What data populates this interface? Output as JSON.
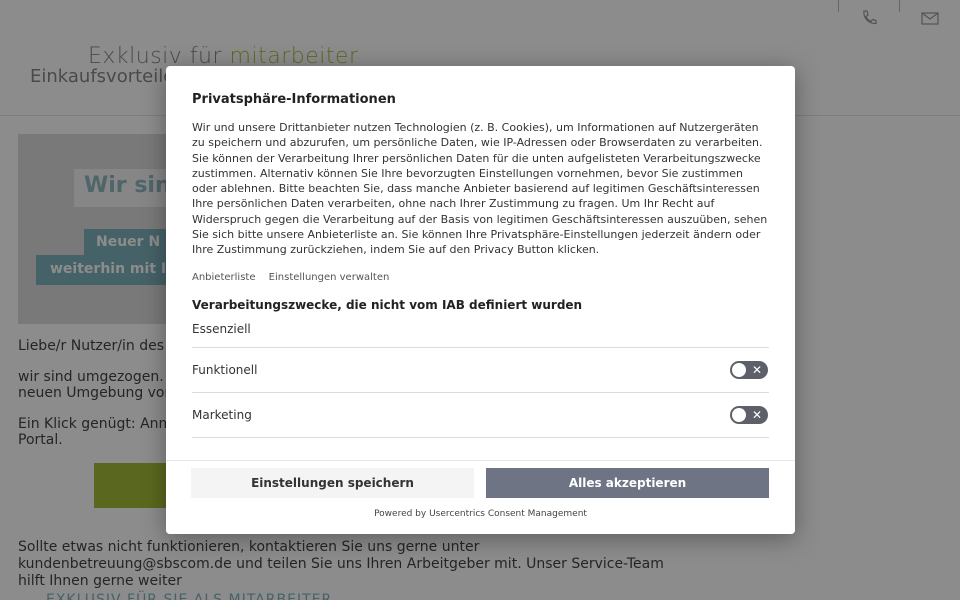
{
  "background": {
    "logo_line1": "Exklusiv für",
    "logo_accent": "mitarbeiter",
    "logo_line2": "Einkaufsvorteile",
    "hero_title": "Wir sind",
    "hero_badge1": "Neuer N",
    "hero_badge2": "weiterhin mit I",
    "greeting": "Liebe/r Nutzer/in des M",
    "para1_line1": "wir sind umgezogen. Ih",
    "para1_line2": "neuen Umgebung von",
    "para2_line1": "Ein Klick genügt: Anme",
    "para2_line2": "Portal.",
    "contact_line1": "Sollte etwas nicht funktionieren, kontaktieren Sie uns gerne unter",
    "contact_email": "kundenbetreuung@sbscom.de",
    "contact_line2_rest": " und teilen Sie uns Ihren Arbeitgeber mit. Unser Service-Team",
    "contact_line3": "hilft Ihnen gerne weiter",
    "footer_link": "EXKLUSIV FÜR SIE ALS MITARBEITER"
  },
  "modal": {
    "title": "Privatsphäre-Informationen",
    "description": "Wir und unsere Drittanbieter nutzen Technologien (z. B. Cookies), um Informationen auf Nutzergeräten zu speichern und abzurufen, um persönliche Daten, wie IP-Adressen oder Browserdaten zu verarbeiten. Sie können der Verarbeitung Ihrer persönlichen Daten für die unten aufgelisteten Verarbeitungszwecke zustimmen. Alternativ können Sie Ihre bevorzugten Einstellungen vornehmen, bevor Sie zustimmen oder ablehnen. Bitte beachten Sie, dass manche Anbieter basierend auf legitimen Geschäftsinteressen Ihre persönlichen Daten verarbeiten, ohne nach Ihrer Zustimmung zu fragen. Um Ihr Recht auf Widerspruch gegen die Verarbeitung auf der Basis von legitimen Geschäftsinteressen auszuüben, sehen Sie sich bitte unsere Anbieterliste an. Sie können Ihre Privatsphäre-Einstellungen jederzeit ändern oder Ihre Zustimmung zurückziehen, indem Sie auf den Privacy Button klicken.",
    "link_vendors": "Anbieterliste",
    "link_settings": "Einstellungen verwalten",
    "section_title": "Verarbeitungszwecke, die nicht vom IAB definiert wurden",
    "categories": [
      {
        "label": "Essenziell"
      },
      {
        "label": "Funktionell",
        "toggle_symbol": "✕"
      },
      {
        "label": "Marketing",
        "toggle_symbol": "✕"
      }
    ],
    "save_button": "Einstellungen speichern",
    "accept_button": "Alles akzeptieren",
    "powered_by": "Powered by Usercentrics Consent Management"
  }
}
